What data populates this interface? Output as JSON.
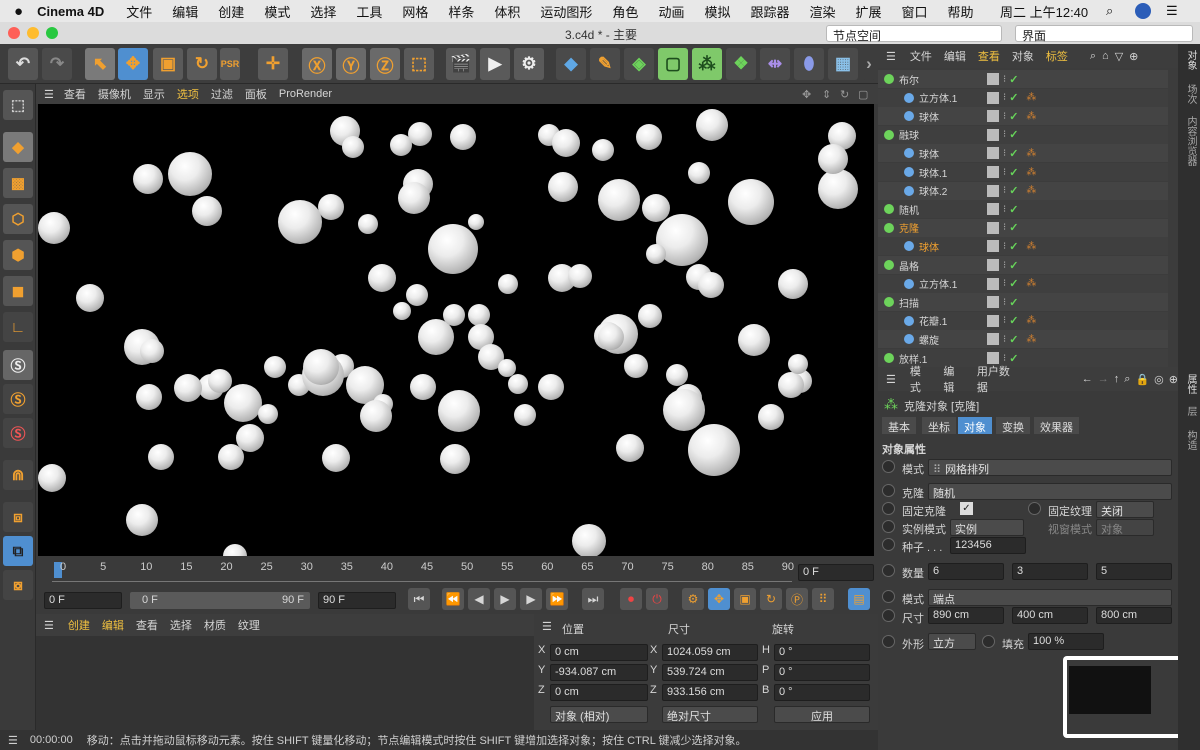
{
  "menubar": {
    "app": "Cinema 4D",
    "items": [
      "文件",
      "编辑",
      "创建",
      "模式",
      "选择",
      "工具",
      "网格",
      "样条",
      "体积",
      "运动图形",
      "角色",
      "动画",
      "模拟",
      "跟踪器",
      "渲染",
      "扩展",
      "窗口",
      "帮助"
    ],
    "clock": "周二 上午12:40"
  },
  "window": {
    "title": "3.c4d * - 主要",
    "node_space": "节点空间",
    "layout": "界面"
  },
  "viewport": {
    "menu": [
      "查看",
      "摄像机",
      "显示",
      "选项",
      "过滤",
      "面板",
      "ProRender"
    ]
  },
  "timeline": {
    "ticks": [
      "0",
      "5",
      "10",
      "15",
      "20",
      "25",
      "30",
      "35",
      "40",
      "45",
      "50",
      "55",
      "60",
      "65",
      "70",
      "75",
      "80",
      "85",
      "90"
    ],
    "current_frame": "0 F",
    "start": "0 F",
    "range_start": "0 F",
    "range_end": "90 F",
    "end": "90 F"
  },
  "materials": {
    "menu": [
      "创建",
      "编辑",
      "查看",
      "选择",
      "材质",
      "纹理"
    ]
  },
  "coords": {
    "headers": [
      "位置",
      "尺寸",
      "旋转"
    ],
    "rows": [
      {
        "axis": "X",
        "pos": "0 cm",
        "size_axis": "X",
        "size": "1024.059 cm",
        "rot_axis": "H",
        "rot": "0 °"
      },
      {
        "axis": "Y",
        "pos": "-934.087 cm",
        "size_axis": "Y",
        "size": "539.724 cm",
        "rot_axis": "P",
        "rot": "0 °"
      },
      {
        "axis": "Z",
        "pos": "0 cm",
        "size_axis": "Z",
        "size": "933.156 cm",
        "rot_axis": "B",
        "rot": "0 °"
      }
    ],
    "mode": "对象 (相对)",
    "size_mode": "绝对尺寸",
    "apply": "应用"
  },
  "status": {
    "time": "00:00:00",
    "message": "移动：点击并拖动鼠标移动元素。按住 SHIFT 键量化移动；节点编辑模式时按住 SHIFT 键增加选择对象；按住 CTRL 键减少选择对象。"
  },
  "objmgr": {
    "menu": [
      "文件",
      "编辑",
      "查看",
      "对象",
      "标签"
    ],
    "objects": [
      {
        "name": "布尔",
        "level": 0
      },
      {
        "name": "立方体.1",
        "level": 1
      },
      {
        "name": "球体",
        "level": 1
      },
      {
        "name": "融球",
        "level": 0
      },
      {
        "name": "球体",
        "level": 1
      },
      {
        "name": "球体.1",
        "level": 1
      },
      {
        "name": "球体.2",
        "level": 1
      },
      {
        "name": "随机",
        "level": 0
      },
      {
        "name": "克隆",
        "level": 0,
        "active": true
      },
      {
        "name": "球体",
        "level": 1,
        "active": true
      },
      {
        "name": "晶格",
        "level": 0
      },
      {
        "name": "立方体.1",
        "level": 1
      },
      {
        "name": "扫描",
        "level": 0
      },
      {
        "name": "花瓣.1",
        "level": 1
      },
      {
        "name": "螺旋",
        "level": 1
      },
      {
        "name": "放样.1",
        "level": 0
      }
    ]
  },
  "attr": {
    "menu": [
      "模式",
      "编辑",
      "用户数据"
    ],
    "title": "克隆对象 [克隆]",
    "tabs": [
      "基本",
      "坐标",
      "对象",
      "变换",
      "效果器"
    ],
    "active_tab": "对象",
    "section": "对象属性",
    "mode_label": "模式",
    "mode_value": "网格排列",
    "clone_label": "克隆",
    "clone_value": "随机",
    "fixed_clone": "固定克隆",
    "fixed_texture": "固定纹理",
    "fixed_texture_value": "关闭",
    "instance_mode": "实例模式",
    "instance_value": "实例",
    "viewport_mode": "视窗模式",
    "viewport_value": "对象",
    "seed_label": "种子 . . .",
    "seed_value": "123456",
    "count_label": "数量",
    "count": [
      "6",
      "3",
      "5"
    ],
    "mode2_label": "模式",
    "mode2_value": "端点",
    "size_label": "尺寸",
    "size": [
      "890 cm",
      "400 cm",
      "800 cm"
    ],
    "shape_label": "外形",
    "shape_value": "立方",
    "fill_label": "填充",
    "fill_value": "100 %"
  },
  "right_strip": [
    "对象",
    "场次",
    "内容浏览器",
    "属性",
    "层",
    "构造"
  ]
}
